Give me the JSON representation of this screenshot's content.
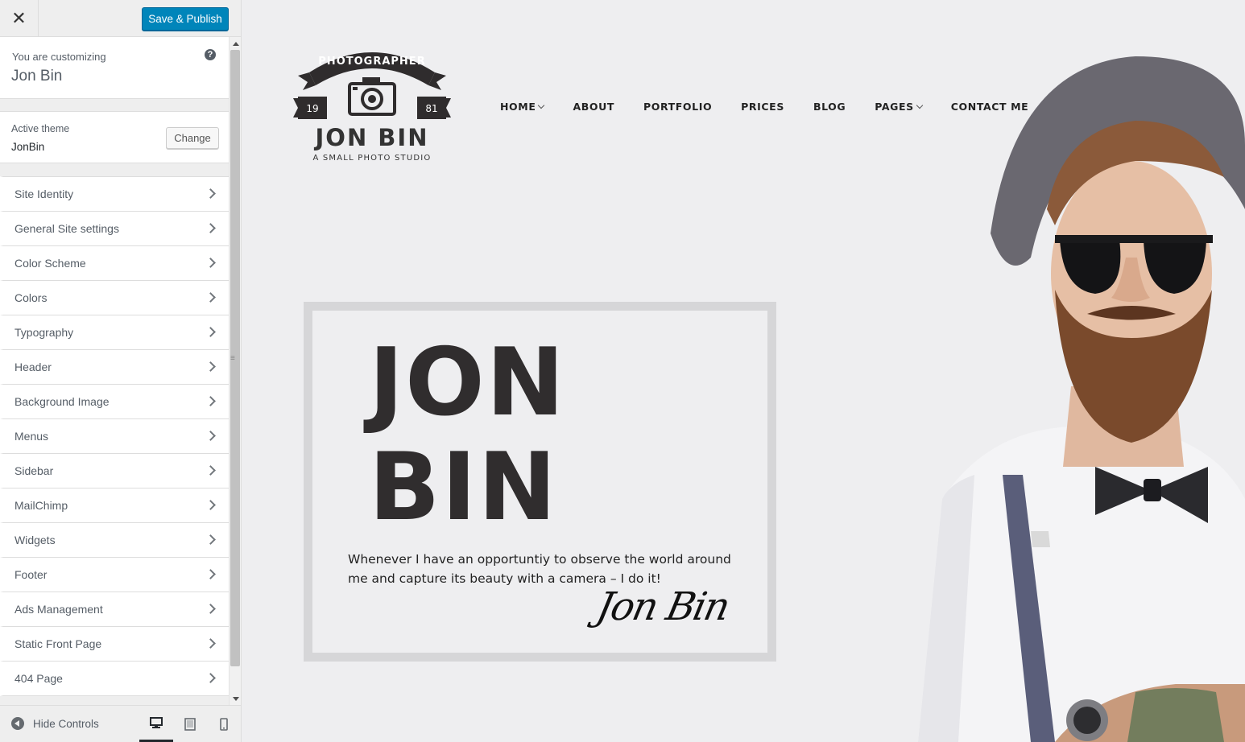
{
  "topbar": {
    "close_symbol": "✕",
    "publish_label": "Save & Publish"
  },
  "customizing": {
    "label": "You are customizing",
    "site_title": "Jon Bin",
    "help_symbol": "?"
  },
  "theme": {
    "label": "Active theme",
    "name": "JonBin",
    "change_label": "Change"
  },
  "sections": [
    {
      "label": "Site Identity"
    },
    {
      "label": "General Site settings"
    },
    {
      "label": "Color Scheme"
    },
    {
      "label": "Colors"
    },
    {
      "label": "Typography"
    },
    {
      "label": "Header"
    },
    {
      "label": "Background Image"
    },
    {
      "label": "Menus"
    },
    {
      "label": "Sidebar"
    },
    {
      "label": "MailChimp"
    },
    {
      "label": "Widgets"
    },
    {
      "label": "Footer"
    },
    {
      "label": "Ads Management"
    },
    {
      "label": "Static Front Page"
    },
    {
      "label": "404 Page"
    }
  ],
  "footer": {
    "hide_label": "Hide Controls",
    "devices": [
      "desktop-icon",
      "tablet-icon",
      "mobile-icon"
    ],
    "active_device": "desktop"
  },
  "site": {
    "logo": {
      "banner_text": "PHOTOGRAPHER",
      "year_left": "19",
      "year_right": "81",
      "name": "JON BIN",
      "tagline": "A SMALL PHOTO STUDIO"
    },
    "nav": [
      {
        "label": "HOME",
        "has_dropdown": true
      },
      {
        "label": "ABOUT",
        "has_dropdown": false
      },
      {
        "label": "PORTFOLIO",
        "has_dropdown": false
      },
      {
        "label": "PRICES",
        "has_dropdown": false
      },
      {
        "label": "BLOG",
        "has_dropdown": false
      },
      {
        "label": "PAGES",
        "has_dropdown": true
      },
      {
        "label": "CONTACT ME",
        "has_dropdown": false
      }
    ],
    "hero": {
      "title_line1": "JON",
      "title_line2": "BIN",
      "text": "Whenever I have an opportuntiy to observe the world around me and capture its beauty with a camera – I do it!",
      "signature": "Jon Bin"
    }
  },
  "colors": {
    "accent": "#0085ba",
    "preview_bg": "#eeeef0",
    "hero_text": "#302d2e"
  }
}
